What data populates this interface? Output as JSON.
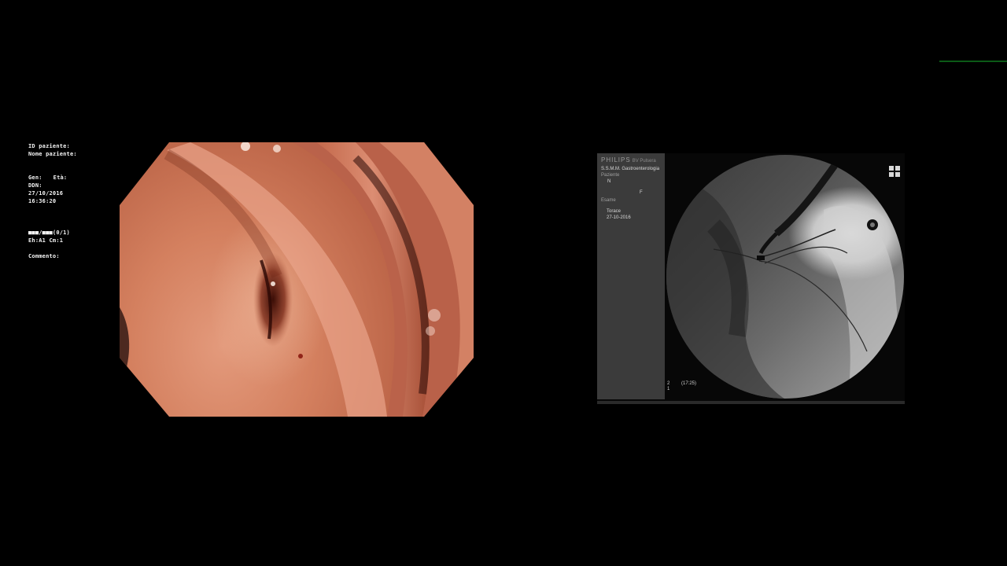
{
  "endoscope_osd": {
    "patient_id": "ID paziente:",
    "patient_name": "Nome paziente:",
    "gender": "Gen:",
    "age": "Età:",
    "dob_label": "DDN:",
    "date": "27/10/2016",
    "time": "16:36:20",
    "image_counter": "■■■/■■■(0/1)",
    "settings": "Eh:A1 Cm:1",
    "comment": "Commento:"
  },
  "fluoroscopy": {
    "brand": "PHILIPS",
    "system": "BV Pulsera",
    "department": "S.S.M.M. Gastroenterologia",
    "patient_label": "Paziente",
    "patient_value": "N",
    "sex_value": "F",
    "exam_label": "Esame",
    "exam_name": "Torace",
    "exam_date": "27-10-2016",
    "footer_left": "2\n1",
    "footer_time": "(17:25)",
    "layout_icon": "grid-four-icon"
  },
  "colors": {
    "background": "#000000",
    "mucosa": "#d4805f",
    "fluoro_panel": "#3b3b3b",
    "accent_line": "#0b5a16"
  }
}
